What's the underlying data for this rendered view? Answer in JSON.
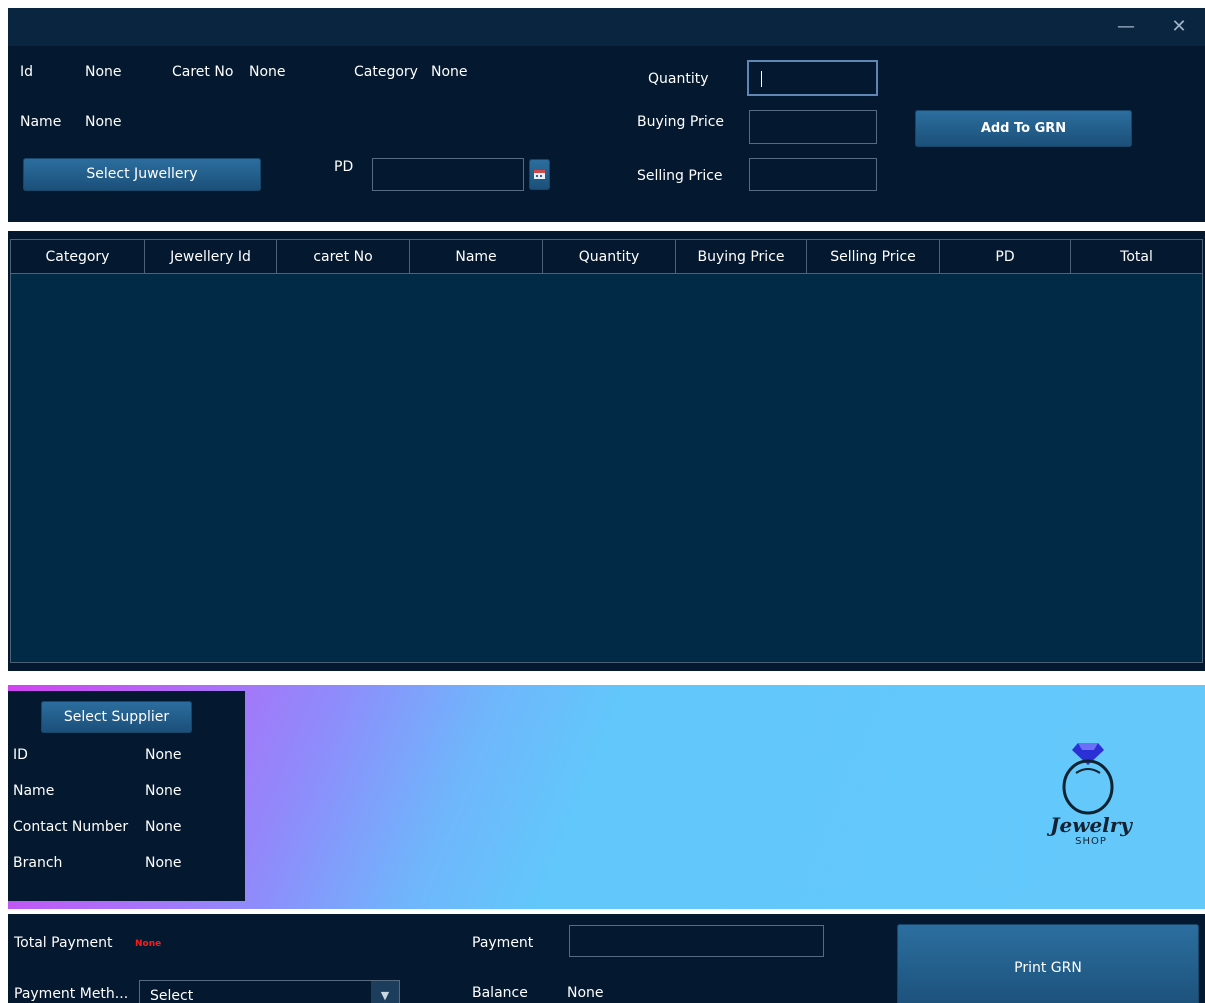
{
  "window": {
    "minimize_glyph": "—",
    "close_glyph": "✕"
  },
  "jewellery": {
    "id_label": "Id",
    "id_value": "None",
    "caret_label": "Caret No",
    "caret_value": "None",
    "category_label": "Category",
    "category_value": "None",
    "name_label": "Name",
    "name_value": "None",
    "select_button": "Select Juwellery",
    "pd_label": "PD",
    "pd_value": ""
  },
  "grn_form": {
    "quantity_label": "Quantity",
    "quantity_value": "",
    "buying_label": "Buying Price",
    "buying_value": "",
    "selling_label": "Selling Price",
    "selling_value": "",
    "add_button": "Add To GRN"
  },
  "table": {
    "columns": [
      "Category",
      "Jewellery Id",
      "caret No",
      "Name",
      "Quantity",
      "Buying Price",
      "Selling Price",
      "PD",
      "Total"
    ],
    "rows": []
  },
  "supplier": {
    "select_button": "Select Supplier",
    "id_label": "ID",
    "id_value": "None",
    "name_label": "Name",
    "name_value": "None",
    "contact_label": "Contact Number",
    "contact_value": "None",
    "branch_label": "Branch",
    "branch_value": "None"
  },
  "logo": {
    "text_main": "Jewelry",
    "text_sub": "SHOP",
    "gem_icon": "diamond-ring-icon"
  },
  "payment": {
    "total_label": "Total Payment",
    "total_value": "None",
    "payment_label": "Payment",
    "payment_value": "",
    "method_label": "Payment Meth...",
    "method_value": "Select",
    "balance_label": "Balance",
    "balance_value": "None",
    "print_button": "Print GRN"
  },
  "colors": {
    "panel_bg": "#04182f",
    "table_bg": "#002a46",
    "button": "#2c6fa0",
    "alert_red": "#ff1a1a",
    "banner_start": "#d044f0",
    "banner_end": "#64c8fb"
  }
}
